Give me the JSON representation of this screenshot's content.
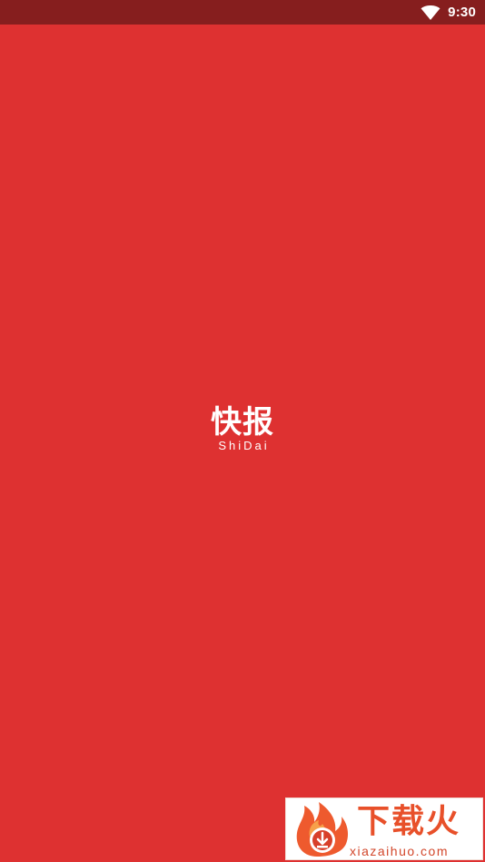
{
  "status_bar": {
    "time": "9:30",
    "icons": [
      "wifi-icon"
    ]
  },
  "splash": {
    "logo_cn": "快报",
    "logo_en": "ShiDai"
  },
  "watermark": {
    "title": "下载火",
    "url": "xiazaihuo.com",
    "icon": "flame-download-icon"
  },
  "colors": {
    "background": "#DE3131",
    "status_bar": "#861E1E",
    "text": "#FFFFFF",
    "watermark_accent": "#E8502A"
  }
}
